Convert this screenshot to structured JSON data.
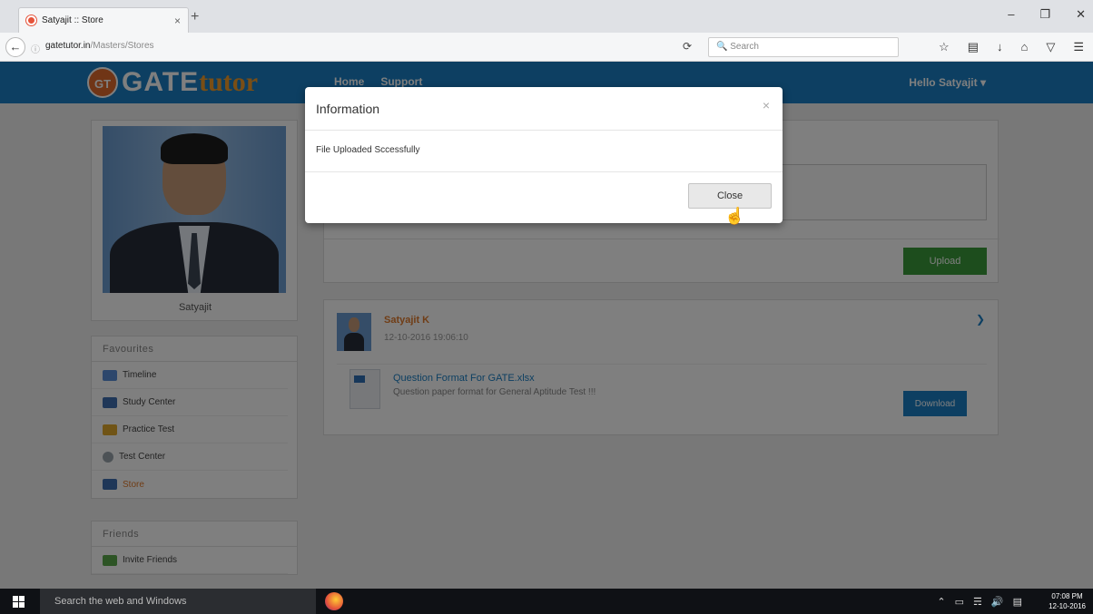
{
  "browser": {
    "tab_title": "Satyajit :: Store",
    "tab_close": "×",
    "new_tab": "+",
    "window_controls": [
      "–",
      "❐",
      "✕"
    ],
    "url_domain": "gatetutor.in",
    "url_path": "/Masters/Stores",
    "search_placeholder": "Search",
    "toolbar_icons": [
      "star-icon",
      "reader-icon",
      "download-icon",
      "home-icon",
      "pocket-icon",
      "menu-icon"
    ]
  },
  "site": {
    "logo_badge": "GT",
    "logo_gate": "GATE",
    "logo_tutor": "tutor",
    "nav": [
      "Home",
      "Support"
    ],
    "greeting": "Hello Satyajit ▾",
    "brand_color": "#1a7fc4"
  },
  "profile": {
    "name": "Satyajit"
  },
  "favourites": {
    "title": "Favourites",
    "items": [
      {
        "label": "Timeline",
        "icon": "timeline-icon",
        "color": "#5a8fd8"
      },
      {
        "label": "Study Center",
        "icon": "study-center-icon",
        "color": "#3f6fb0"
      },
      {
        "label": "Practice Test",
        "icon": "practice-test-icon",
        "color": "#e0a82c"
      },
      {
        "label": "Test Center",
        "icon": "test-center-icon",
        "color": "#9aa4ad"
      },
      {
        "label": "Store",
        "icon": "store-icon",
        "color": "#3f6fb0"
      }
    ]
  },
  "friends": {
    "title": "Friends",
    "items": [
      {
        "label": "Invite Friends",
        "icon": "invite-friends-icon",
        "color": "#5aa84a"
      }
    ]
  },
  "upload": {
    "button_label": "Upload"
  },
  "post": {
    "author": "Satyajit K",
    "timestamp": "12-10-2016 19:06:10",
    "file_title": "Question Format For GATE.xlsx",
    "file_description": "Question paper format for General Aptitude Test !!!",
    "download_label": "Download"
  },
  "modal": {
    "title": "Information",
    "close_x": "×",
    "message": "File Uploaded Sccessfully",
    "close_button": "Close"
  },
  "taskbar": {
    "search_text": "Search the web and Windows",
    "time": "07:08 PM",
    "date": "12-10-2016"
  }
}
